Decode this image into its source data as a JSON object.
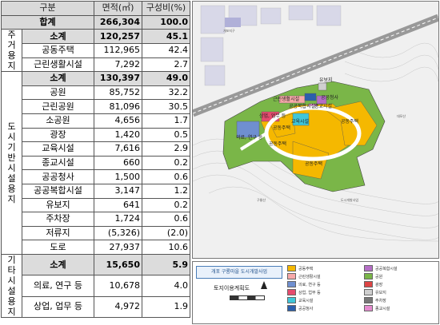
{
  "table": {
    "header": {
      "category": "구분",
      "area": "면적(㎡)",
      "ratio": "구성비(%)"
    },
    "total": {
      "label": "합계",
      "area": "266,304",
      "ratio": "100.0"
    },
    "groups": [
      {
        "name": "주거용지",
        "subtotal": {
          "label": "소계",
          "area": "120,257",
          "ratio": "45.1"
        },
        "rows": [
          {
            "label": "공동주택",
            "area": "112,965",
            "ratio": "42.4"
          },
          {
            "label": "근린생활시설",
            "area": "7,292",
            "ratio": "2.7"
          }
        ]
      },
      {
        "name": "도시기반시설용지",
        "subtotal": {
          "label": "소계",
          "area": "130,397",
          "ratio": "49.0"
        },
        "park": {
          "label": "공원",
          "area": "85,752",
          "ratio": "32.2"
        },
        "park_rows": [
          {
            "label": "근린공원",
            "area": "81,096",
            "ratio": "30.5"
          },
          {
            "label": "소공원",
            "area": "4,656",
            "ratio": "1.7"
          }
        ],
        "rows": [
          {
            "label": "광장",
            "area": "1,420",
            "ratio": "0.5"
          },
          {
            "label": "교육시설",
            "area": "7,616",
            "ratio": "2.9"
          },
          {
            "label": "종교시설",
            "area": "660",
            "ratio": "0.2"
          },
          {
            "label": "공공청사",
            "area": "1,500",
            "ratio": "0.6"
          },
          {
            "label": "공공복합시설",
            "area": "3,147",
            "ratio": "1.2"
          },
          {
            "label": "유보지",
            "area": "641",
            "ratio": "0.2"
          },
          {
            "label": "주차장",
            "area": "1,724",
            "ratio": "0.6"
          },
          {
            "label": "저류지",
            "area": "(5,326)",
            "ratio": "(2.0)"
          },
          {
            "label": "도로",
            "area": "27,937",
            "ratio": "10.6"
          }
        ]
      },
      {
        "name": "기타시설용지",
        "subtotal": {
          "label": "소계",
          "area": "15,650",
          "ratio": "5.9"
        },
        "rows": [
          {
            "label": "의료, 연구 등",
            "area": "10,678",
            "ratio": "4.0"
          },
          {
            "label": "상업, 업무 등",
            "area": "4,972",
            "ratio": "1.9"
          }
        ]
      }
    ]
  },
  "map": {
    "labels": {
      "yuboji": "유보지",
      "neighborhood": "근린생활시설",
      "public_complex": "공공복합시설",
      "public_office": "공공청사",
      "religious": "종교시설",
      "commercial": "상업, 업무 등",
      "school": "교육시설",
      "medical": "의료, 연구 등",
      "apartment_1": "공동주택",
      "apartment_2": "공동주택",
      "apartment_3": "공동주택",
      "apartment_4": "공동주택",
      "road_small_1": "개포지구",
      "road_small_2": "도시개발사업",
      "road_small_3": "구룡산",
      "road_small_4": "대모산"
    },
    "colors": {
      "apartment": "#f5b800",
      "park": "#7ab648",
      "school": "#3fc6d8",
      "medical": "#6f8fd0",
      "road": "#ffffff",
      "public": "#c44"
    }
  },
  "legend": {
    "title": "개포 구룡마을 도시개발사업",
    "subtitle": "토지이용계획도",
    "items": [
      {
        "label": "공동주택",
        "color": "#f5b800"
      },
      {
        "label": "공공복합시설",
        "color": "#b56ec6"
      },
      {
        "label": "근린생활시설",
        "color": "#f7a9a9"
      },
      {
        "label": "공원",
        "color": "#7ab648"
      },
      {
        "label": "의료, 연구 등",
        "color": "#6f8fd0"
      },
      {
        "label": "광장",
        "color": "#d44"
      },
      {
        "label": "상업, 업무 등",
        "color": "#e64b6e"
      },
      {
        "label": "유보지",
        "color": "#cfcfcf"
      },
      {
        "label": "교육시설",
        "color": "#3fc6d8"
      },
      {
        "label": "주차장",
        "color": "#777"
      },
      {
        "label": "공공청사",
        "color": "#2b5fad"
      },
      {
        "label": "",
        "color": "#ffffff"
      },
      {
        "label": "종교시설",
        "color": "#e58bd0"
      }
    ]
  }
}
